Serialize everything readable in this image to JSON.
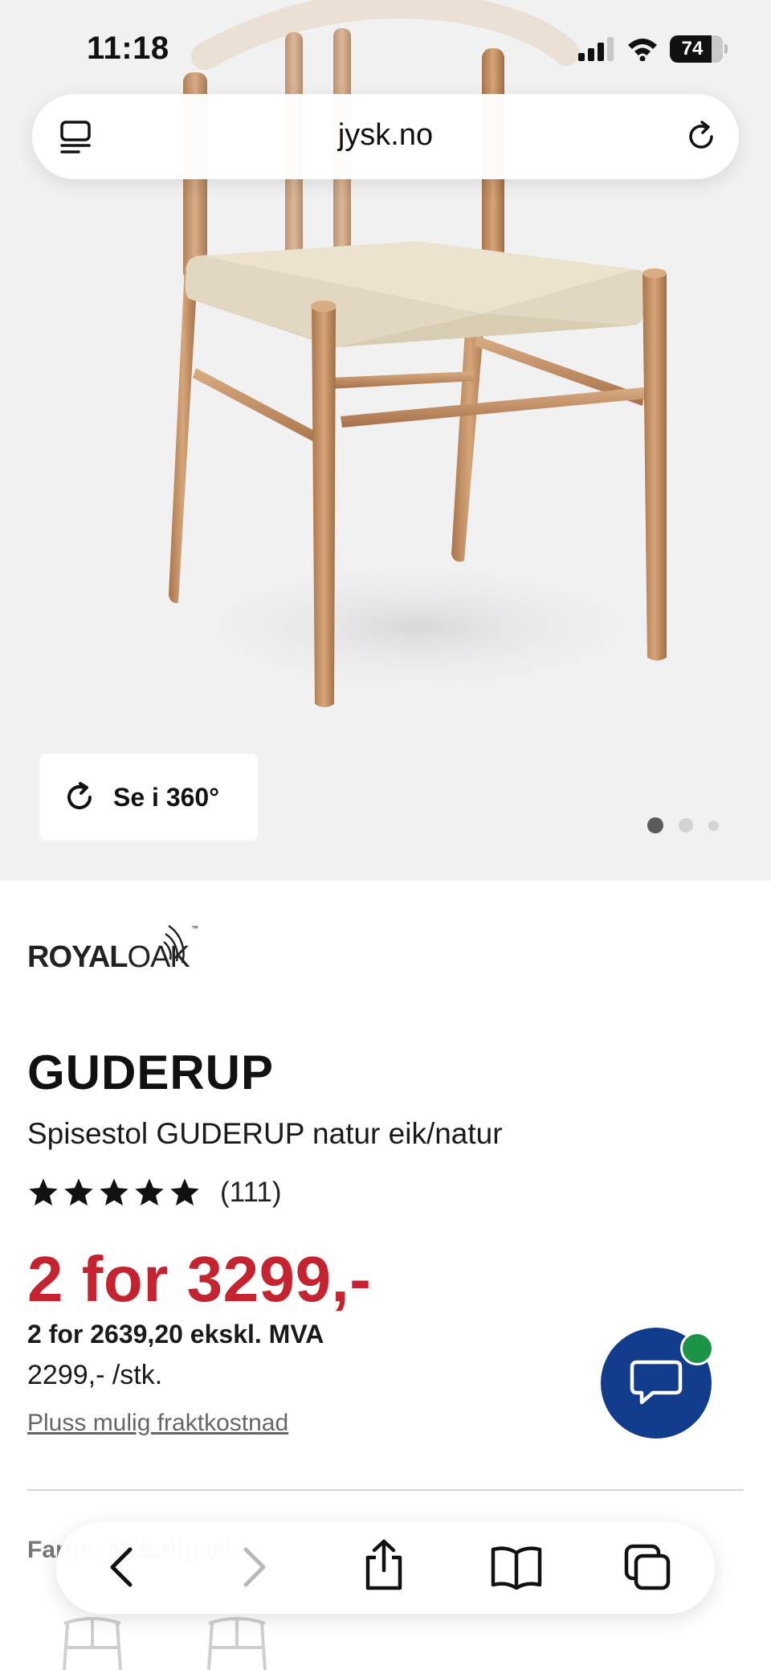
{
  "status_bar": {
    "time": "11:18",
    "battery": "74"
  },
  "browser": {
    "url": "jysk.no"
  },
  "product": {
    "view_360_label": "Se i 360°",
    "brand_left": "ROYAL",
    "brand_right": "OAK",
    "brand_tm": "™",
    "name": "GUDERUP",
    "description": "Spisestol GUDERUP natur eik/natur",
    "rating_stars": 5,
    "review_count": "(111)",
    "price": "2 for 3299,-",
    "price_ex_vat": "2 for 2639,20 ekskl. MVA",
    "unit_price": "2299,- /stk.",
    "shipping_note": "Pluss mulig fraktkostnad",
    "partially_hidden_text": "Farge: Naturlig eik"
  },
  "gallery": {
    "current_slide": 1,
    "slide_count": 3
  },
  "colors": {
    "price": "#c4232f",
    "chat": "#123d8c",
    "online": "#1c9445"
  },
  "icons": [
    "tabs-icon",
    "reload-icon",
    "rotate-360-icon",
    "star-icon",
    "chat-icon",
    "back-icon",
    "forward-icon",
    "share-icon",
    "bookmarks-icon",
    "tabs-overview-icon"
  ]
}
